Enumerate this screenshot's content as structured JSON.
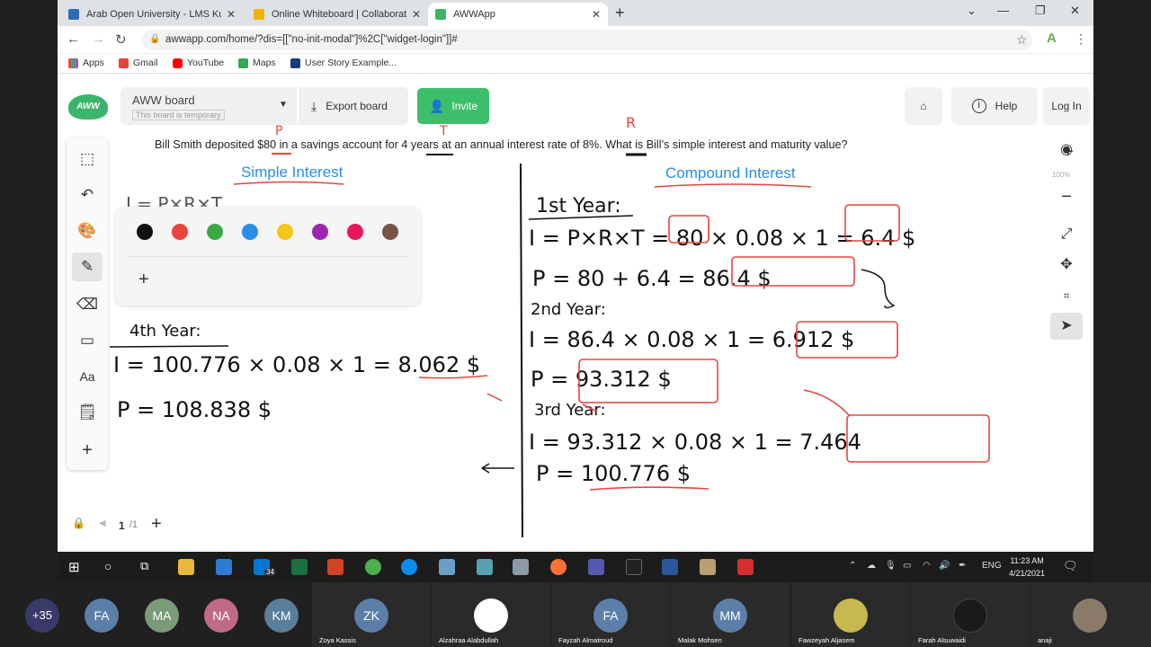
{
  "browser": {
    "tabs": [
      {
        "title": "Arab Open University - LMS Kuw",
        "close": "✕"
      },
      {
        "title": "Online Whiteboard | Collaborativ",
        "close": "✕"
      },
      {
        "title": "AWWApp",
        "close": "✕"
      }
    ],
    "new_tab": "+",
    "url": "awwapp.com/home/?dis=[[\"no-init-modal\"]%2C[\"widget-login\"]]#",
    "bookmarks": [
      "Apps",
      "Gmail",
      "YouTube",
      "Maps",
      "User Story Example..."
    ],
    "profile_initial": "A"
  },
  "app": {
    "logo": "AWW",
    "board_name": "AWW board",
    "board_temp_note": "This board is temporary",
    "export_label": "Export board",
    "invite_label": "Invite",
    "help_label": "Help",
    "login_label": "Log In",
    "zoom": "100%",
    "page_indicator": "1",
    "page_total": "/1"
  },
  "question": "Bill Smith deposited $80 in a savings account for 4 years at an annual interest rate of 8%. What is Bill’s simple interest and maturity value?",
  "whiteboard": {
    "left_heading": "Simple Interest",
    "right_heading": "Compound Interest",
    "handwriting_right": [
      "1st Year:",
      "I = P×R×T = 80 × 0.08 × 1 = 6.4 $",
      "P = 80 + 6.4 = 86.4 $",
      "2nd Year:",
      "I = 86.4 × 0.08 × 1 = 6.912 $",
      "P = 93.312 $",
      "3rd Year:",
      "I = 93.312 × 0.08 × 1 = 7.464",
      "P = 100.776 $"
    ],
    "handwriting_left": [
      "I = P×R×T",
      "4th Year:",
      "I = 100.776 × 0.08 × 1 = 8.062 $",
      "P = 108.838 $"
    ],
    "palette_colors": [
      "#111111",
      "#e8453c",
      "#3aa845",
      "#2b8de8",
      "#f5c518",
      "#9b27b0",
      "#e8175d",
      "#795548"
    ]
  },
  "taskbar": {
    "lang": "ENG",
    "time": "11:23 AM",
    "date": "4/21/2021",
    "mail_badge": "34"
  },
  "participants": [
    {
      "initials": "+35",
      "name": "",
      "color": "#3a3a6a"
    },
    {
      "initials": "FA",
      "name": "",
      "color": "#5b7fa8"
    },
    {
      "initials": "MA",
      "name": "",
      "color": "#7a9a7a"
    },
    {
      "initials": "NA",
      "name": "",
      "color": "#c06a8a"
    },
    {
      "initials": "KM",
      "name": "",
      "color": "#5b7f9a"
    },
    {
      "initials": "ZK",
      "name": "Zoya Kassis",
      "color": "#5b7fa8"
    },
    {
      "initials": "",
      "name": "Alzahraa Alabdullah",
      "color": "#ffffff"
    },
    {
      "initials": "FA",
      "name": "Fayzah Almatroud",
      "color": "#5b7fa8"
    },
    {
      "initials": "MM",
      "name": "Malak Mohsen",
      "color": "#5b7fa8"
    },
    {
      "initials": "",
      "name": "Fawzeyah Aljasem",
      "color": "#c8b850"
    },
    {
      "initials": "",
      "name": "Farah Alsuwaidi",
      "color": "#1a1a1a"
    },
    {
      "initials": "",
      "name": "anaji",
      "color": "#8a7a6a"
    }
  ]
}
